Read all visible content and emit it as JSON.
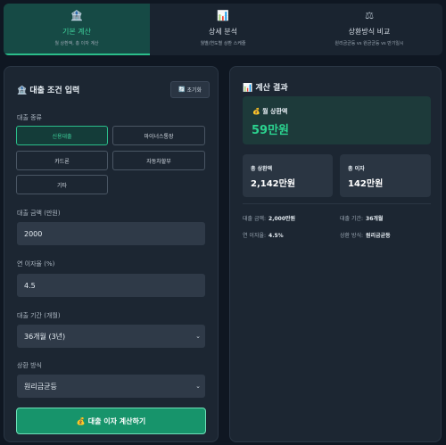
{
  "tabs": [
    {
      "icon": "🏦",
      "title": "기본 계산",
      "subtitle": "월 상환액, 총 이자 계산"
    },
    {
      "icon": "📊",
      "title": "상세 분석",
      "subtitle": "월별/연도별 상환 스케줄"
    },
    {
      "icon": "⚖",
      "title": "상환방식 비교",
      "subtitle": "원리금균등 vs 원금균등 vs 만기일시"
    }
  ],
  "left": {
    "icon": "🏦",
    "title": "대출 조건 입력",
    "reset_icon": "🔄",
    "reset_label": "초기화",
    "loan_type_label": "대출 종류",
    "loan_types": [
      "신용대출",
      "마이너스통장",
      "카드론",
      "자동차할부",
      "기타"
    ],
    "selected_loan_type": "신용대출",
    "amount_label": "대출 금액 (만원)",
    "amount_value": "2000",
    "rate_label": "연 이자율 (%)",
    "rate_value": "4.5",
    "period_label": "대출 기간 (개월)",
    "period_value": "36개월 (3년)",
    "method_label": "상환 방식",
    "method_value": "원리금균등",
    "calc_icon": "💰",
    "calc_label": "대출 이자 계산하기"
  },
  "right": {
    "icon": "📊",
    "title": "계산 결과",
    "monthly_icon": "💰",
    "monthly_label": "월 상환액",
    "monthly_value": "59만원",
    "total_repay_label": "총 상환액",
    "total_repay_value": "2,142만원",
    "total_interest_label": "총 이자",
    "total_interest_value": "142만원",
    "details": {
      "amount_label": "대출 금액:",
      "amount_value": "2,000만원",
      "period_label": "대출 기간:",
      "period_value": "36개월",
      "rate_label": "연 이자율:",
      "rate_value": "4.5%",
      "method_label": "상환 방식:",
      "method_value": "원리금균등"
    }
  }
}
